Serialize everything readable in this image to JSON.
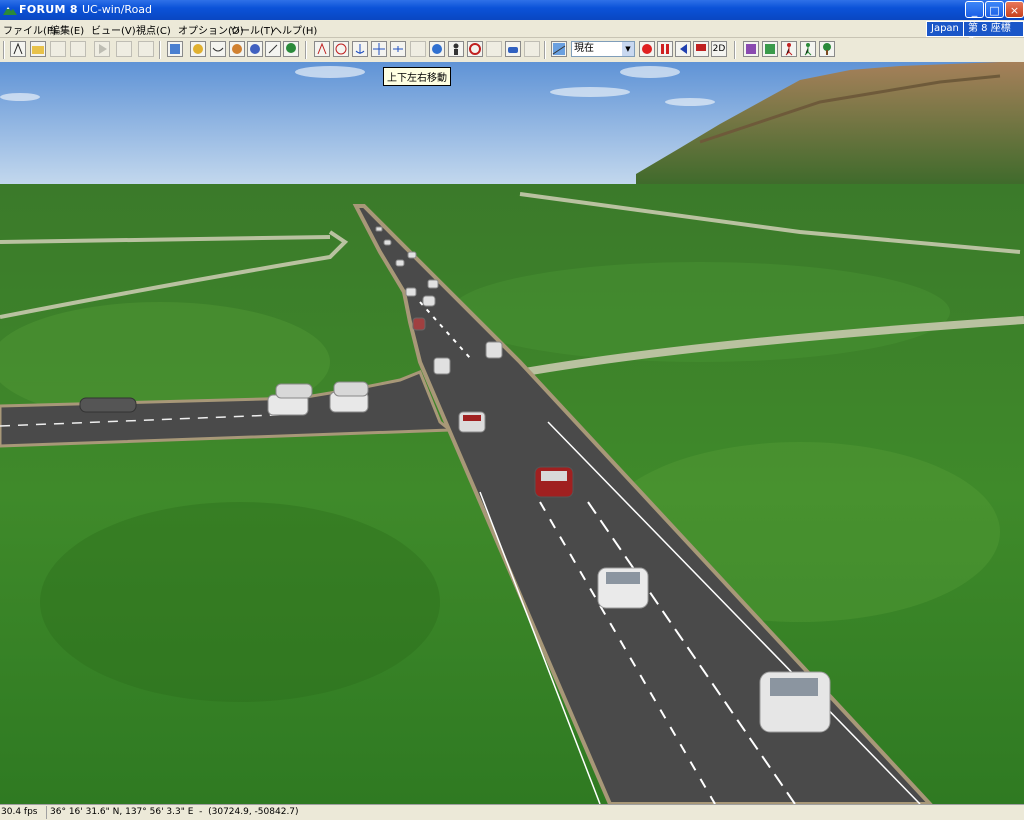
{
  "window": {
    "brand": "FORUM 8",
    "title": "UC-win/Road",
    "minimize": "_",
    "maximize": "□",
    "close": "×"
  },
  "menu": {
    "items": [
      "ファイル(F)",
      "編集(E)",
      "ビュー(V)",
      "視点(C)",
      "オプション(O)",
      "ツール(T)",
      "ヘルプ(H)"
    ],
    "badge_region": "Japan",
    "badge_coord": "第 8 座標系"
  },
  "toolbar": {
    "time_select_value": "現在",
    "mode_2d": "2D",
    "tooltip": "上下左右移動"
  },
  "status": {
    "fps": "30.4 fps",
    "coordinates": "36° 16' 31.6\" N, 137° 56' 3.3\" E  -  (30724.9, -50842.7)"
  },
  "colors": {
    "titlebar": "#0b52d8",
    "grass": "#3f8a2a",
    "road": "#4a4a4a",
    "sky": "#8fb6e0"
  }
}
